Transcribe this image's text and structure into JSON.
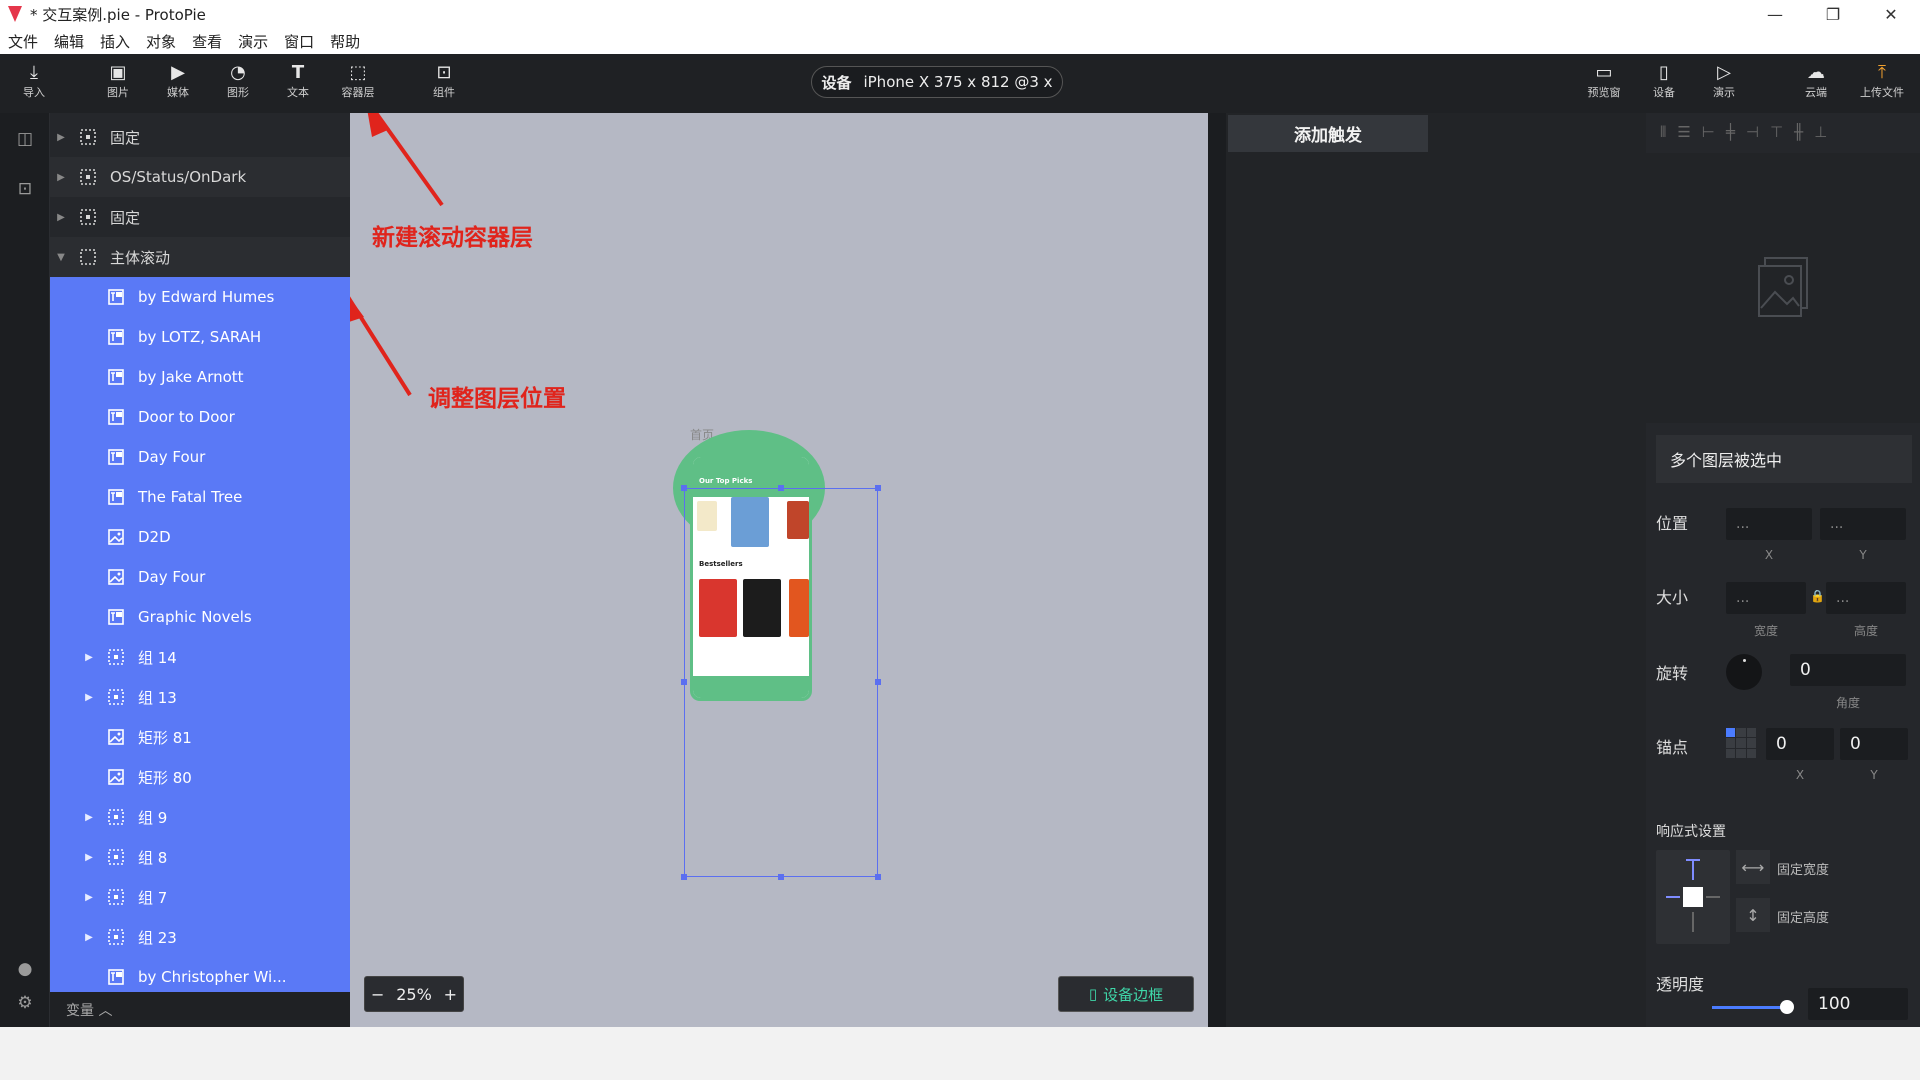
{
  "window": {
    "title": "* 交互案例.pie - ProtoPie",
    "controls": [
      "—",
      "❐",
      "✕"
    ]
  },
  "menu": [
    "文件",
    "编辑",
    "插入",
    "对象",
    "查看",
    "演示",
    "窗口",
    "帮助"
  ],
  "toolbar": {
    "left_tools": [
      {
        "label": "导入",
        "icon": "import-icon"
      },
      {
        "label": "图片",
        "icon": "image-icon"
      },
      {
        "label": "媒体",
        "icon": "media-icon"
      },
      {
        "label": "图形",
        "icon": "shape-icon"
      },
      {
        "label": "文本",
        "icon": "text-icon"
      },
      {
        "label": "容器层",
        "icon": "container-icon"
      },
      {
        "label": "组件",
        "icon": "component-icon"
      }
    ],
    "device": {
      "label": "设备",
      "value": "iPhone X  375 x 812  @3 x"
    },
    "right_tools": [
      {
        "label": "预览窗",
        "icon": "preview-icon"
      },
      {
        "label": "设备",
        "icon": "device-icon"
      },
      {
        "label": "演示",
        "icon": "play-icon"
      },
      {
        "label": "云端",
        "icon": "cloud-icon"
      },
      {
        "label": "上传文件",
        "icon": "upload-icon"
      }
    ]
  },
  "layers": {
    "items": [
      {
        "label": "固定",
        "type": "container",
        "arrow": "right",
        "indent": 0,
        "state": "normal"
      },
      {
        "label": "OS/Status/OnDark",
        "type": "container",
        "arrow": "right",
        "indent": 0,
        "state": "dark"
      },
      {
        "label": "固定",
        "type": "container",
        "arrow": "right",
        "indent": 0,
        "state": "normal"
      },
      {
        "label": "主体滚动",
        "type": "scroll",
        "arrow": "down",
        "indent": 0,
        "state": "dark"
      },
      {
        "label": "by Edward Humes",
        "type": "text",
        "arrow": "",
        "indent": 1,
        "state": "selected"
      },
      {
        "label": "by LOTZ, SARAH",
        "type": "text",
        "arrow": "",
        "indent": 1,
        "state": "selected"
      },
      {
        "label": "by Jake Arnott",
        "type": "text",
        "arrow": "",
        "indent": 1,
        "state": "selected"
      },
      {
        "label": "Door to Door",
        "type": "text",
        "arrow": "",
        "indent": 1,
        "state": "selected"
      },
      {
        "label": "Day Four",
        "type": "text",
        "arrow": "",
        "indent": 1,
        "state": "selected"
      },
      {
        "label": "The Fatal Tree",
        "type": "text",
        "arrow": "",
        "indent": 1,
        "state": "selected"
      },
      {
        "label": "D2D",
        "type": "image",
        "arrow": "",
        "indent": 1,
        "state": "selected"
      },
      {
        "label": "Day Four",
        "type": "image",
        "arrow": "",
        "indent": 1,
        "state": "selected"
      },
      {
        "label": "Graphic Novels",
        "type": "text",
        "arrow": "",
        "indent": 1,
        "state": "selected"
      },
      {
        "label": "组 14",
        "type": "container",
        "arrow": "right",
        "indent": 1,
        "state": "selected"
      },
      {
        "label": "组 13",
        "type": "container",
        "arrow": "right",
        "indent": 1,
        "state": "selected"
      },
      {
        "label": "矩形 81",
        "type": "image",
        "arrow": "",
        "indent": 1,
        "state": "selected"
      },
      {
        "label": "矩形 80",
        "type": "image",
        "arrow": "",
        "indent": 1,
        "state": "selected"
      },
      {
        "label": "组 9",
        "type": "container",
        "arrow": "right",
        "indent": 1,
        "state": "selected"
      },
      {
        "label": "组 8",
        "type": "container",
        "arrow": "right",
        "indent": 1,
        "state": "selected"
      },
      {
        "label": "组 7",
        "type": "container",
        "arrow": "right",
        "indent": 1,
        "state": "selected"
      },
      {
        "label": "组 23",
        "type": "container",
        "arrow": "right",
        "indent": 1,
        "state": "selected"
      },
      {
        "label": "by Christopher Wi...",
        "type": "text",
        "arrow": "",
        "indent": 1,
        "state": "selected"
      }
    ],
    "variables_label": "变量 ︿"
  },
  "canvas": {
    "frame_label": "首页",
    "phone": {
      "header": "Our Top Picks",
      "section": "Bestsellers"
    },
    "zoom": {
      "minus": "−",
      "value": "25%",
      "plus": "+"
    },
    "device_frame_button": "设备边框"
  },
  "annotations": {
    "new_scroll_container": "新建滚动容器层",
    "adjust_layer_position": "调整图层位置"
  },
  "trigger_panel": {
    "add_trigger": "添加触发"
  },
  "properties": {
    "selection_title": "多个图层被选中",
    "position": {
      "label": "位置",
      "x": "...",
      "y": "...",
      "x_sub": "X",
      "y_sub": "Y"
    },
    "size": {
      "label": "大小",
      "w": "...",
      "h": "...",
      "w_sub": "宽度",
      "h_sub": "高度"
    },
    "rotation": {
      "label": "旋转",
      "value": "0",
      "sub": "角度"
    },
    "anchor": {
      "label": "锚点",
      "x": "0",
      "y": "0",
      "x_sub": "X",
      "y_sub": "Y"
    },
    "responsive": {
      "label": "响应式设置",
      "fixed_width": "固定宽度",
      "fixed_height": "固定高度"
    },
    "opacity": {
      "label": "透明度",
      "value": "100",
      "level": 1.0
    }
  },
  "colors": {
    "selected_row": "#5a79f6",
    "accent": "#4b7cff",
    "annotation": "#e0241c",
    "phone_green": "#5fbf86"
  }
}
